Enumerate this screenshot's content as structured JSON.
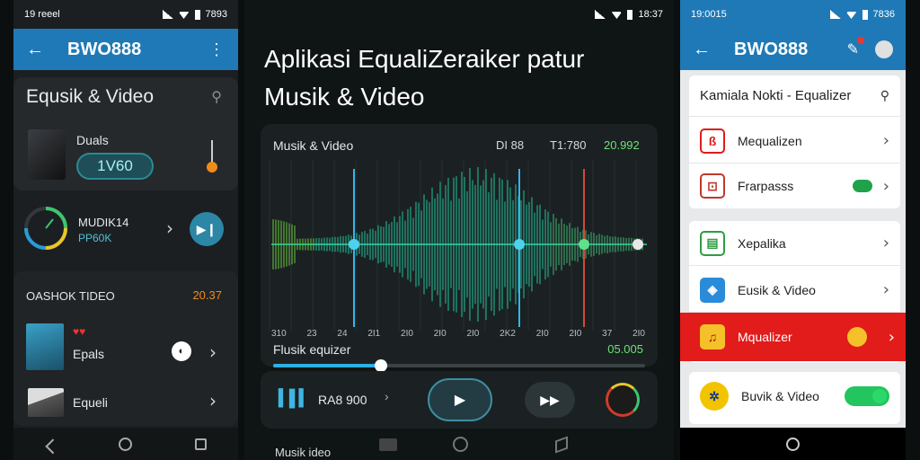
{
  "left": {
    "status": {
      "left_text": "19 reeel",
      "right_text": "7893"
    },
    "appbar": {
      "title": "BWO888"
    },
    "header": {
      "title": "Equsik & Video"
    },
    "card1": {
      "label": "Duals",
      "button": "1V60"
    },
    "card2": {
      "name": "MUDIK14",
      "sub": "PP60K"
    },
    "section": {
      "title": "OASHOK TIDEO",
      "value": "20.37"
    },
    "list": [
      {
        "label": "Epals"
      },
      {
        "label": "Equeli"
      }
    ]
  },
  "middle": {
    "status": {
      "time": "18:37"
    },
    "title_line1": "Aplikasi EqualiZeraiker patur",
    "title_line2": "Musik & Video",
    "eq": {
      "label": "Musik & Video",
      "v1": "DI 88",
      "v2": "T1:780",
      "v3": "20.992",
      "ticks": [
        "310",
        "23",
        "24",
        "2I1",
        "2I0",
        "2I0",
        "2I0",
        "2K2",
        "2I0",
        "2I0",
        "37",
        "2I0"
      ],
      "sub_label": "Flusik equizer",
      "sub_value": "05.005",
      "progress": 0.29
    },
    "controls": {
      "track": "RA8 900"
    },
    "footer": "Musik ideo"
  },
  "right": {
    "status": {
      "left_text": "19:0015",
      "right_text": "7836"
    },
    "appbar": {
      "title": "BWO888"
    },
    "search": {
      "label": "Kamiala Nokti - Equalizer"
    },
    "items": [
      {
        "label": "Mequalizen"
      },
      {
        "label": "Frarpasss"
      },
      {
        "label": "Xepalika"
      },
      {
        "label": "Eusik & Video"
      },
      {
        "label": "Mqualizer"
      },
      {
        "label": "Buvik & Video"
      }
    ]
  },
  "colors": {
    "accent": "#1f79b6",
    "teal": "#2b8a93",
    "green": "#6ee07a",
    "red": "#e21b1b",
    "orange": "#ee8c1a"
  }
}
